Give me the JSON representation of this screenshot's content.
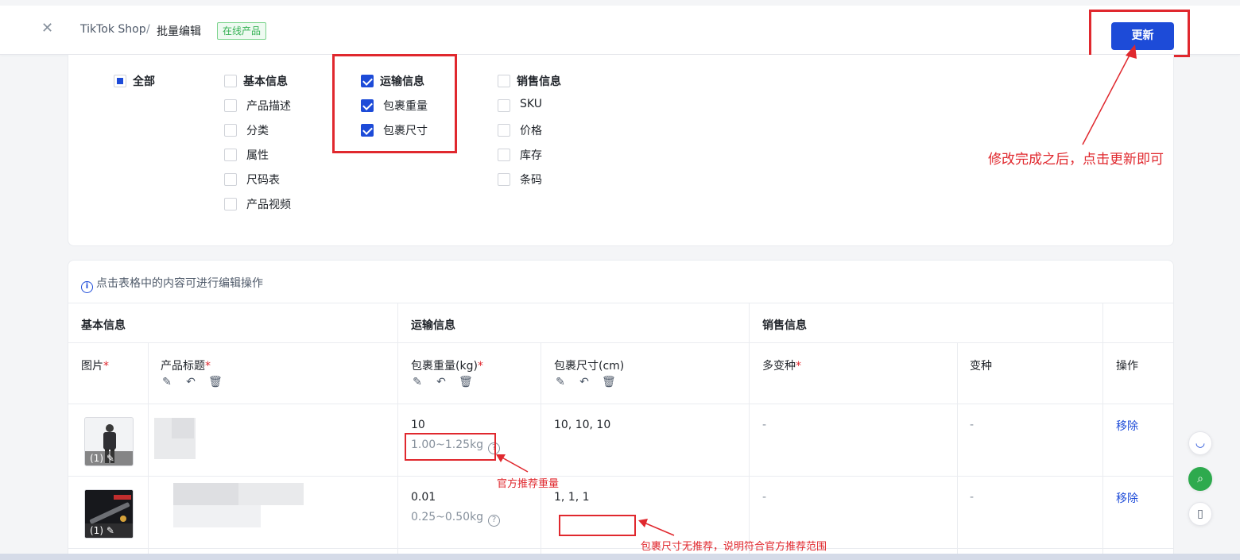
{
  "header": {
    "close_icon": "close-icon",
    "crumb_shop": "TikTok Shop",
    "crumb_sep": "/",
    "crumb_page": "批量编辑",
    "status_tag": "在线产品",
    "update_label": "更新"
  },
  "filters": {
    "all": "全部",
    "basic": {
      "title": "基本信息",
      "items": [
        "产品描述",
        "分类",
        "属性",
        "尺码表",
        "产品视频"
      ]
    },
    "shipping": {
      "title": "运输信息",
      "items": [
        "包裹重量",
        "包裹尺寸"
      ]
    },
    "sales": {
      "title": "销售信息",
      "items": [
        "SKU",
        "价格",
        "库存",
        "条码"
      ]
    }
  },
  "annotations": {
    "update_hint": "修改完成之后，点击更新即可",
    "weight_hint": "官方推荐重量",
    "size_hint": "包裹尺寸无推荐，说明符合官方推荐范围"
  },
  "table": {
    "tip": "点击表格中的内容可进行编辑操作",
    "groups": [
      "基本信息",
      "运输信息",
      "销售信息"
    ],
    "columns": {
      "image": "图片",
      "title": "产品标题",
      "weight": "包裹重量(kg)",
      "size": "包裹尺寸(cm)",
      "multi_variant": "多变种",
      "variant": "变种",
      "action": "操作"
    },
    "rows": [
      {
        "count": "(1)",
        "weight": "10",
        "weight_range": "1.00~1.25kg",
        "size": "10, 10, 10",
        "multi_variant": "-",
        "variant": "-",
        "action": "移除"
      },
      {
        "count": "(1)",
        "weight": "0.01",
        "weight_range": "0.25~0.50kg",
        "size": "1, 1, 1",
        "multi_variant": "-",
        "variant": "-",
        "action": "移除"
      }
    ],
    "required_mark": "*"
  },
  "side_buttons": [
    "headset-icon",
    "search-icon",
    "phone-icon"
  ]
}
